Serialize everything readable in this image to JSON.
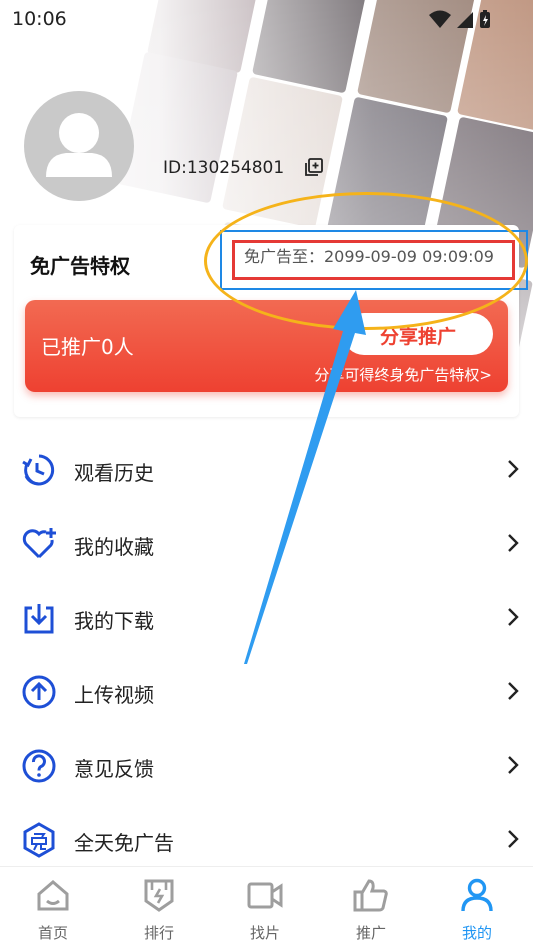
{
  "status_bar": {
    "time": "10:06"
  },
  "profile": {
    "user_id": "ID:130254801"
  },
  "ad_free": {
    "title": "免广告特权",
    "expiry": "免广告至：2099-09-09 09:09:09"
  },
  "promotion": {
    "count_label": "已推广0人",
    "share_button": "分享推广",
    "note": "分享可得终身免广告特权>"
  },
  "menu": [
    {
      "label": "观看历史",
      "icon": "history-icon"
    },
    {
      "label": "我的收藏",
      "icon": "favorite-heart-icon"
    },
    {
      "label": "我的下载",
      "icon": "download-icon"
    },
    {
      "label": "上传视频",
      "icon": "upload-icon"
    },
    {
      "label": "意见反馈",
      "icon": "question-icon"
    },
    {
      "label": "全天免广告",
      "icon": "ad-free-badge-icon"
    }
  ],
  "tabs": [
    {
      "label": "首页",
      "icon": "home-icon"
    },
    {
      "label": "排行",
      "icon": "ranking-icon"
    },
    {
      "label": "找片",
      "icon": "video-camera-icon"
    },
    {
      "label": "推广",
      "icon": "thumbs-up-icon"
    },
    {
      "label": "我的",
      "icon": "profile-icon"
    }
  ],
  "colors": {
    "accent": "#2196f3",
    "promo": "#ee4131",
    "highlight_ellipse": "#f5b31a",
    "highlight_box_red": "#e53935",
    "highlight_box_blue": "#1e88e5"
  }
}
